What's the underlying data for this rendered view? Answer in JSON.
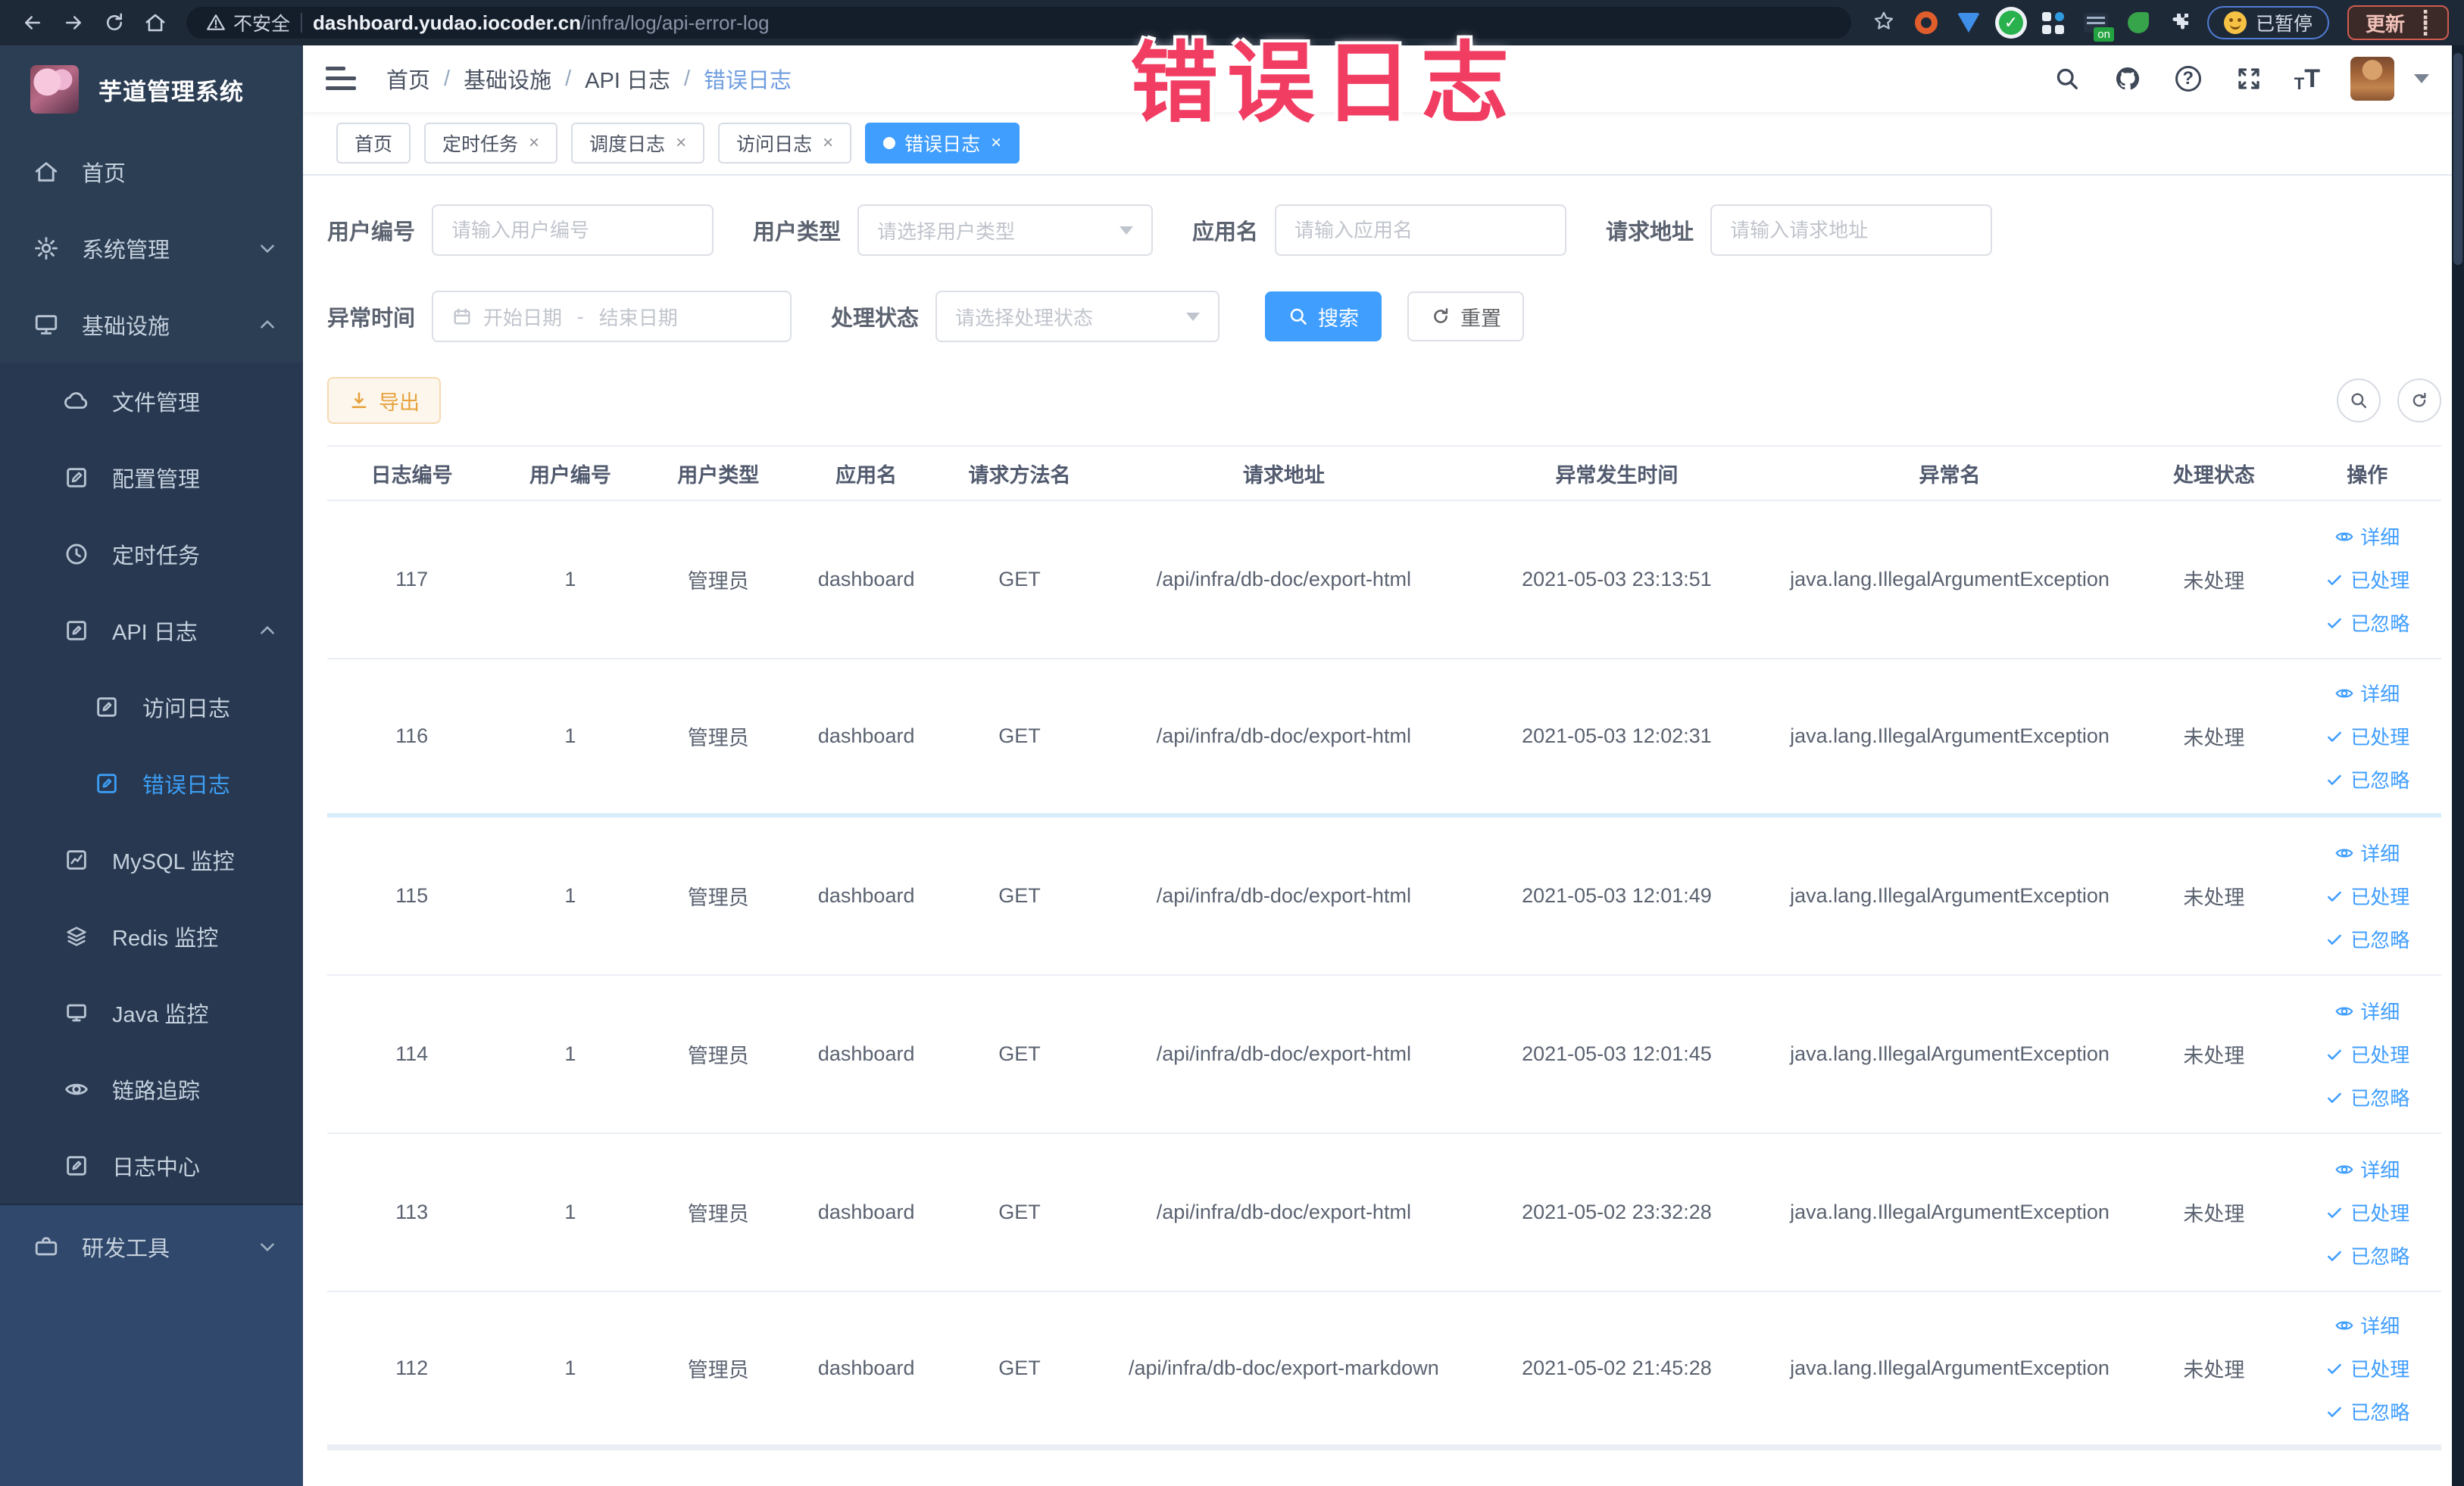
{
  "colors": {
    "accent": "#409eff",
    "annotation": "#f23d63",
    "export": "#e6a23c",
    "sidebar_bg": "#2c3e54"
  },
  "annotation": {
    "text": "错误日志"
  },
  "browser": {
    "security_label": "不安全",
    "url_host": "dashboard.yudao.iocoder.cn",
    "url_path": "/infra/log/api-error-log",
    "extension_icons": [
      "star-icon",
      "orange-ring-icon",
      "blue-shield-icon",
      "green-check-icon",
      "grid-icon",
      "list-on-icon",
      "green-leaf-icon",
      "puzzle-icon"
    ],
    "paused_badge": "已暂停",
    "update_button": "更新"
  },
  "sidebar": {
    "title": "芋道管理系统",
    "items": [
      {
        "name": "home",
        "icon": "home",
        "label": "首页",
        "indent": 0,
        "chevron": null,
        "active": false,
        "zone": "base"
      },
      {
        "name": "system-management",
        "icon": "gear",
        "label": "系统管理",
        "indent": 0,
        "chevron": "down",
        "active": false,
        "zone": "base"
      },
      {
        "name": "infrastructure",
        "icon": "monitor",
        "label": "基础设施",
        "indent": 0,
        "chevron": "up",
        "active": false,
        "zone": "base"
      },
      {
        "name": "file-management",
        "icon": "cloud",
        "label": "文件管理",
        "indent": 1,
        "chevron": null,
        "active": false,
        "zone": "sub"
      },
      {
        "name": "config-management",
        "icon": "pencil",
        "label": "配置管理",
        "indent": 1,
        "chevron": null,
        "active": false,
        "zone": "sub"
      },
      {
        "name": "scheduled-tasks",
        "icon": "clock",
        "label": "定时任务",
        "indent": 1,
        "chevron": null,
        "active": false,
        "zone": "sub"
      },
      {
        "name": "api-log",
        "icon": "doc",
        "label": "API 日志",
        "indent": 1,
        "chevron": "up",
        "active": false,
        "zone": "sub"
      },
      {
        "name": "access-log",
        "icon": "doc",
        "label": "访问日志",
        "indent": 2,
        "chevron": null,
        "active": false,
        "zone": "sub"
      },
      {
        "name": "error-log",
        "icon": "doc",
        "label": "错误日志",
        "indent": 2,
        "chevron": null,
        "active": true,
        "zone": "sub"
      },
      {
        "name": "mysql-monitor",
        "icon": "chart",
        "label": "MySQL 监控",
        "indent": 1,
        "chevron": null,
        "active": false,
        "zone": "sub"
      },
      {
        "name": "redis-monitor",
        "icon": "layers",
        "label": "Redis 监控",
        "indent": 1,
        "chevron": null,
        "active": false,
        "zone": "sub"
      },
      {
        "name": "java-monitor",
        "icon": "screen",
        "label": "Java 监控",
        "indent": 1,
        "chevron": null,
        "active": false,
        "zone": "sub"
      },
      {
        "name": "trace",
        "icon": "eye",
        "label": "链路追踪",
        "indent": 1,
        "chevron": null,
        "active": false,
        "zone": "sub"
      },
      {
        "name": "log-center",
        "icon": "doc",
        "label": "日志中心",
        "indent": 1,
        "chevron": null,
        "active": false,
        "zone": "sub"
      },
      {
        "name": "dev-tools",
        "icon": "briefcase",
        "label": "研发工具",
        "indent": 0,
        "chevron": "down",
        "active": false,
        "zone": "base2"
      }
    ]
  },
  "breadcrumb": {
    "items": [
      "首页",
      "基础设施",
      "API 日志",
      "错误日志"
    ]
  },
  "tabs": [
    {
      "name": "tab-home",
      "label": "首页",
      "closable": false,
      "active": false
    },
    {
      "name": "tab-scheduled-tasks",
      "label": "定时任务",
      "closable": true,
      "active": false
    },
    {
      "name": "tab-schedule-log",
      "label": "调度日志",
      "closable": true,
      "active": false
    },
    {
      "name": "tab-access-log",
      "label": "访问日志",
      "closable": true,
      "active": false
    },
    {
      "name": "tab-error-log",
      "label": "错误日志",
      "closable": true,
      "active": true
    }
  ],
  "filters": {
    "user_id": {
      "label": "用户编号",
      "placeholder": "请输入用户编号"
    },
    "user_type": {
      "label": "用户类型",
      "placeholder": "请选择用户类型"
    },
    "app_name": {
      "label": "应用名",
      "placeholder": "请输入应用名"
    },
    "request_url": {
      "label": "请求地址",
      "placeholder": "请输入请求地址"
    },
    "exception_time": {
      "label": "异常时间",
      "start_placeholder": "开始日期",
      "separator": "-",
      "end_placeholder": "结束日期"
    },
    "process_status": {
      "label": "处理状态",
      "placeholder": "请选择处理状态"
    },
    "search_button": "搜索",
    "reset_button": "重置"
  },
  "toolbar": {
    "export_button": "导出"
  },
  "table": {
    "columns": [
      "日志编号",
      "用户编号",
      "用户类型",
      "应用名",
      "请求方法名",
      "请求地址",
      "异常发生时间",
      "异常名",
      "处理状态",
      "操作"
    ],
    "action_labels": [
      "详细",
      "已处理",
      "已忽略"
    ],
    "rows": [
      {
        "id": "117",
        "user_id": "1",
        "user_type": "管理员",
        "app": "dashboard",
        "method": "GET",
        "url": "/api/infra/db-doc/export-html",
        "time": "2021-05-03 23:13:51",
        "exception": "java.lang.IllegalArgumentException",
        "status": "未处理"
      },
      {
        "id": "116",
        "user_id": "1",
        "user_type": "管理员",
        "app": "dashboard",
        "method": "GET",
        "url": "/api/infra/db-doc/export-html",
        "time": "2021-05-03 12:02:31",
        "exception": "java.lang.IllegalArgumentException",
        "status": "未处理"
      },
      {
        "id": "115",
        "user_id": "1",
        "user_type": "管理员",
        "app": "dashboard",
        "method": "GET",
        "url": "/api/infra/db-doc/export-html",
        "time": "2021-05-03 12:01:49",
        "exception": "java.lang.IllegalArgumentException",
        "status": "未处理"
      },
      {
        "id": "114",
        "user_id": "1",
        "user_type": "管理员",
        "app": "dashboard",
        "method": "GET",
        "url": "/api/infra/db-doc/export-html",
        "time": "2021-05-03 12:01:45",
        "exception": "java.lang.IllegalArgumentException",
        "status": "未处理"
      },
      {
        "id": "113",
        "user_id": "1",
        "user_type": "管理员",
        "app": "dashboard",
        "method": "GET",
        "url": "/api/infra/db-doc/export-html",
        "time": "2021-05-02 23:32:28",
        "exception": "java.lang.IllegalArgumentException",
        "status": "未处理"
      },
      {
        "id": "112",
        "user_id": "1",
        "user_type": "管理员",
        "app": "dashboard",
        "method": "GET",
        "url": "/api/infra/db-doc/export-markdown",
        "time": "2021-05-02 21:45:28",
        "exception": "java.lang.IllegalArgumentException",
        "status": "未处理"
      }
    ]
  }
}
